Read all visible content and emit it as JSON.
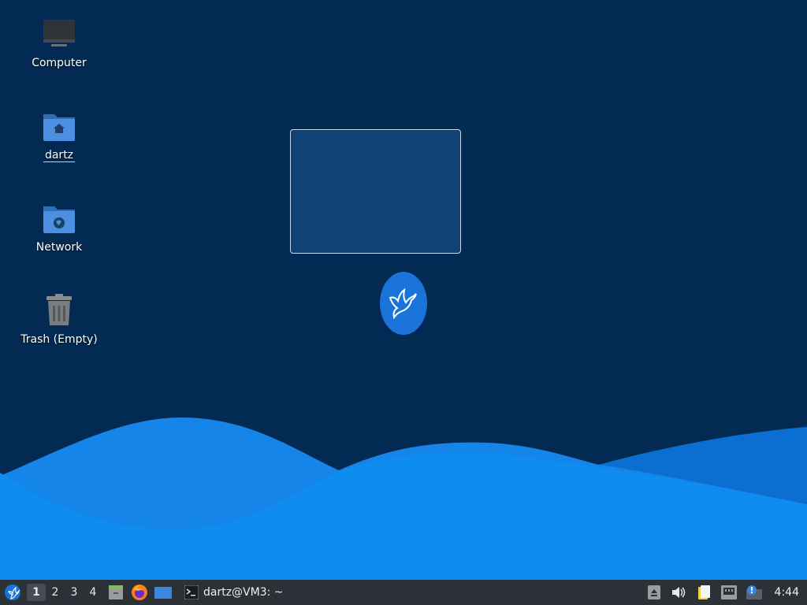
{
  "desktop": {
    "icons": [
      {
        "label": "Computer",
        "icon": "computer-icon"
      },
      {
        "label": "dartz",
        "icon": "home-folder-icon"
      },
      {
        "label": "Network",
        "icon": "network-folder-icon"
      },
      {
        "label": "Trash (Empty)",
        "icon": "trash-icon"
      }
    ],
    "selected_icon": "dartz"
  },
  "taskbar": {
    "workspaces": [
      "1",
      "2",
      "3",
      "4"
    ],
    "active_workspace": "1",
    "launchers": [
      "whisker-menu-icon",
      "file-manager-icon",
      "firefox-icon",
      "show-desktop-icon"
    ],
    "task": {
      "label": "dartz@VM3: ~",
      "icon": "terminal-icon"
    },
    "tray": [
      "eject-icon",
      "volume-icon",
      "clipboard-icon",
      "network-wired-icon",
      "update-notifier-icon"
    ],
    "clock": "4:44"
  },
  "colors": {
    "background": "#032a52",
    "wave_light": "#0f8cf0",
    "wave_dark": "#0a6fd0",
    "taskbar": "#2c3137",
    "accent": "#1a73d8"
  }
}
